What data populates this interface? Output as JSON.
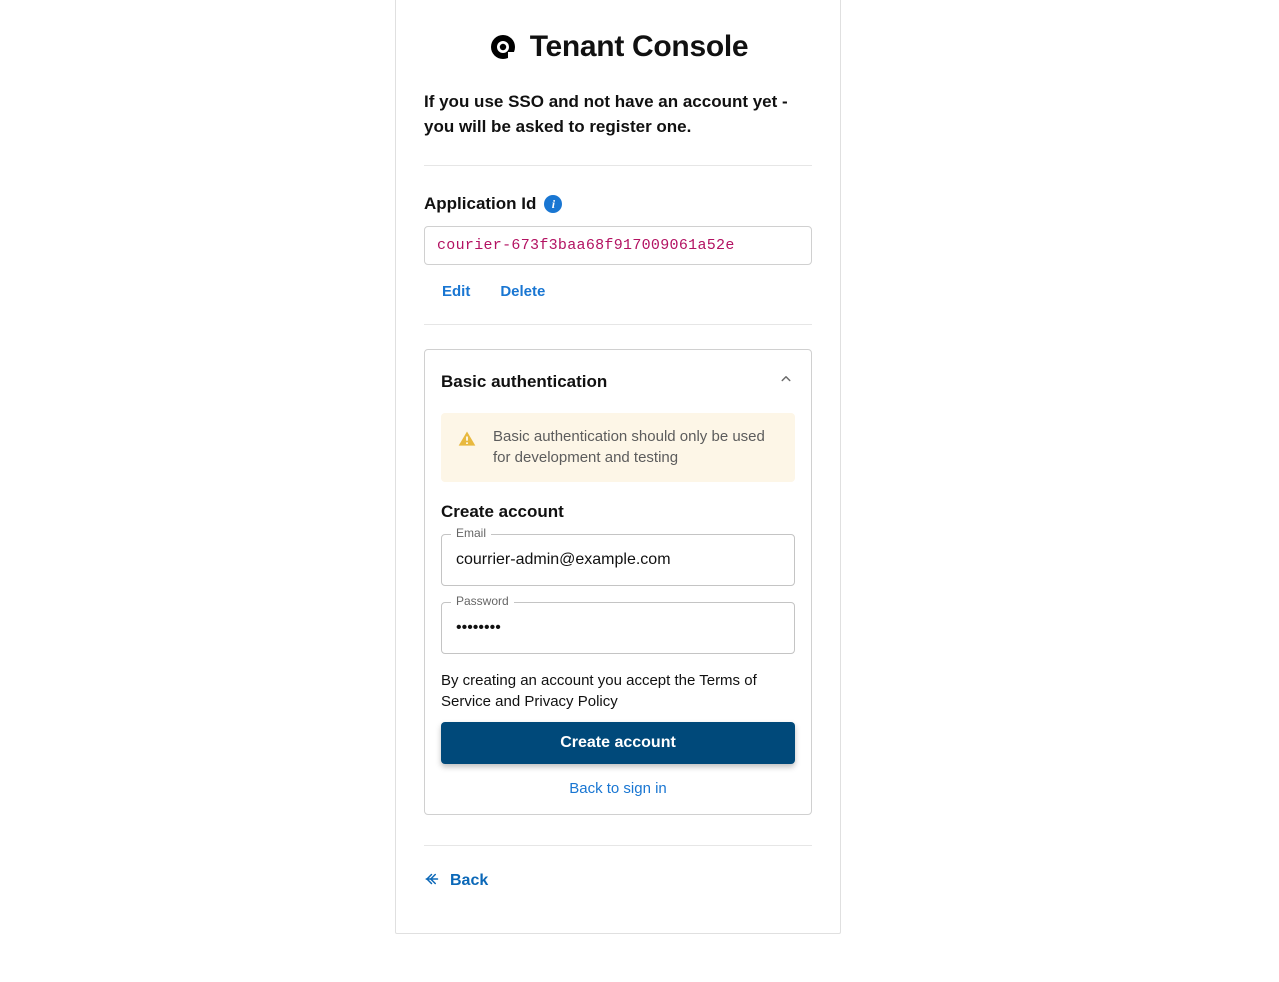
{
  "header": {
    "title": "Tenant Console",
    "subtitle": "If you use SSO and not have an account yet - you will be asked to register one."
  },
  "app_id": {
    "label": "Application Id",
    "value": "courier-673f3baa68f917009061a52e",
    "edit_label": "Edit",
    "delete_label": "Delete"
  },
  "auth": {
    "title": "Basic authentication",
    "warning": "Basic authentication should only be used for development and testing",
    "create_title": "Create account",
    "email_label": "Email",
    "email_value": "courrier-admin@example.com",
    "password_label": "Password",
    "password_value": "••••••••",
    "terms": "By creating an account you accept the Terms of Service and Privacy Policy",
    "submit_label": "Create account",
    "back_to_signin": "Back to sign in"
  },
  "footer": {
    "back_label": "Back"
  }
}
